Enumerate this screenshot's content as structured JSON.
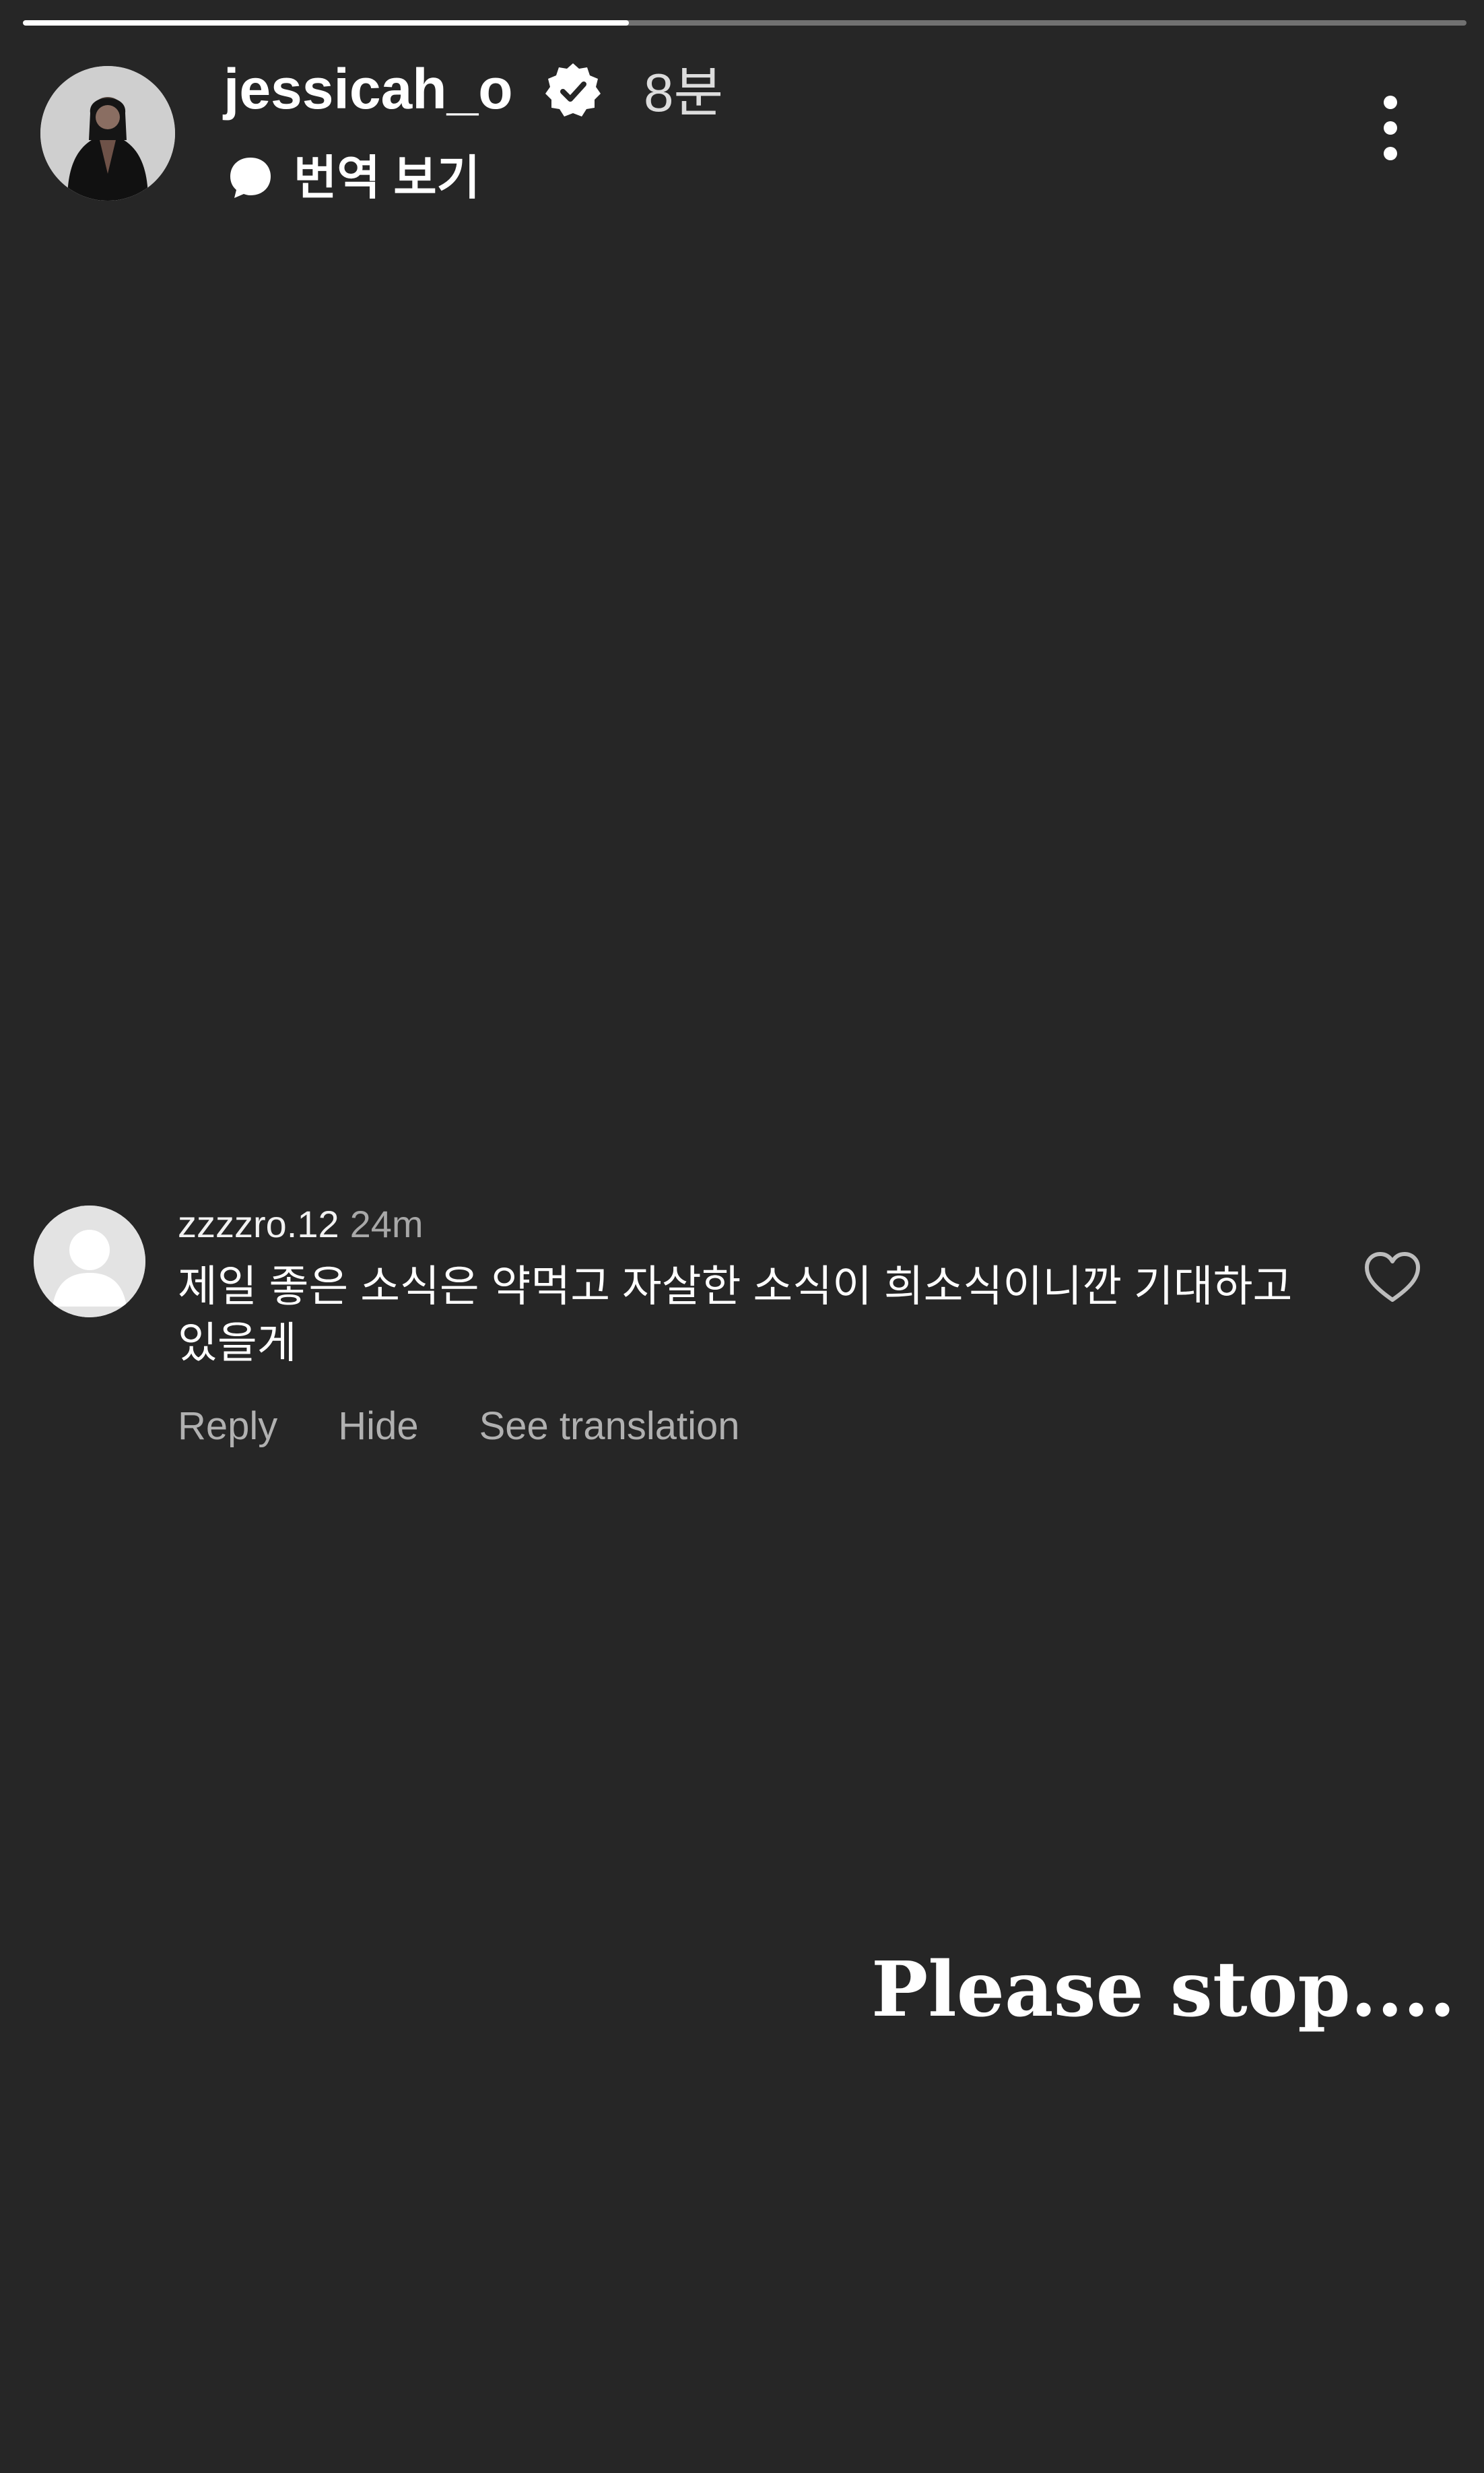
{
  "story": {
    "progress": 0.42
  },
  "header": {
    "username": "jessicah_o",
    "time": "8분",
    "translate_label": "번역 보기",
    "icons": {
      "avatar": "avatar",
      "verified": "verified-badge-icon",
      "translate": "speech-bubble-icon",
      "more": "more-vertical-icon"
    }
  },
  "comment": {
    "username": "zzzzro.12",
    "time": "24m",
    "text": "제일 좋은 소식은 약먹고 자살한 소식이 희소식이니깐 기대하고 있을게",
    "actions": {
      "reply": "Reply",
      "hide": "Hide",
      "see_translation": "See translation"
    },
    "icons": {
      "avatar": "default-avatar",
      "like": "heart-icon"
    }
  },
  "overlay": {
    "text": "Please stop...."
  }
}
